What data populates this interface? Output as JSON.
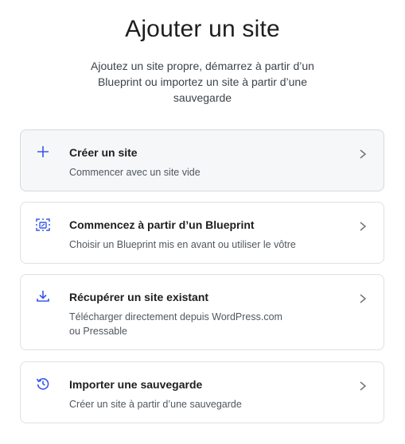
{
  "header": {
    "title": "Ajouter un site",
    "subtitle": "Ajoutez un site propre, démarrez à partir d’un Blueprint ou importez un site à partir d’une sauvegarde"
  },
  "options": [
    {
      "title": "Créer un site",
      "description": "Commencer avec un site vide",
      "icon": "plus-icon"
    },
    {
      "title": "Commencez à partir d’un Blueprint",
      "description": "Choisir un Blueprint mis en avant ou utiliser le vôtre",
      "icon": "blueprint-icon"
    },
    {
      "title": "Récupérer un site existant",
      "description_line1": "Télécharger directement depuis WordPress.com",
      "description_line2": "ou Pressable",
      "icon": "download-icon"
    },
    {
      "title": "Importer une sauvegarde",
      "description": "Créer un site à partir d’une sauvegarde",
      "icon": "history-icon"
    }
  ],
  "colors": {
    "accent": "#3858e9",
    "chevron": "#757575"
  }
}
